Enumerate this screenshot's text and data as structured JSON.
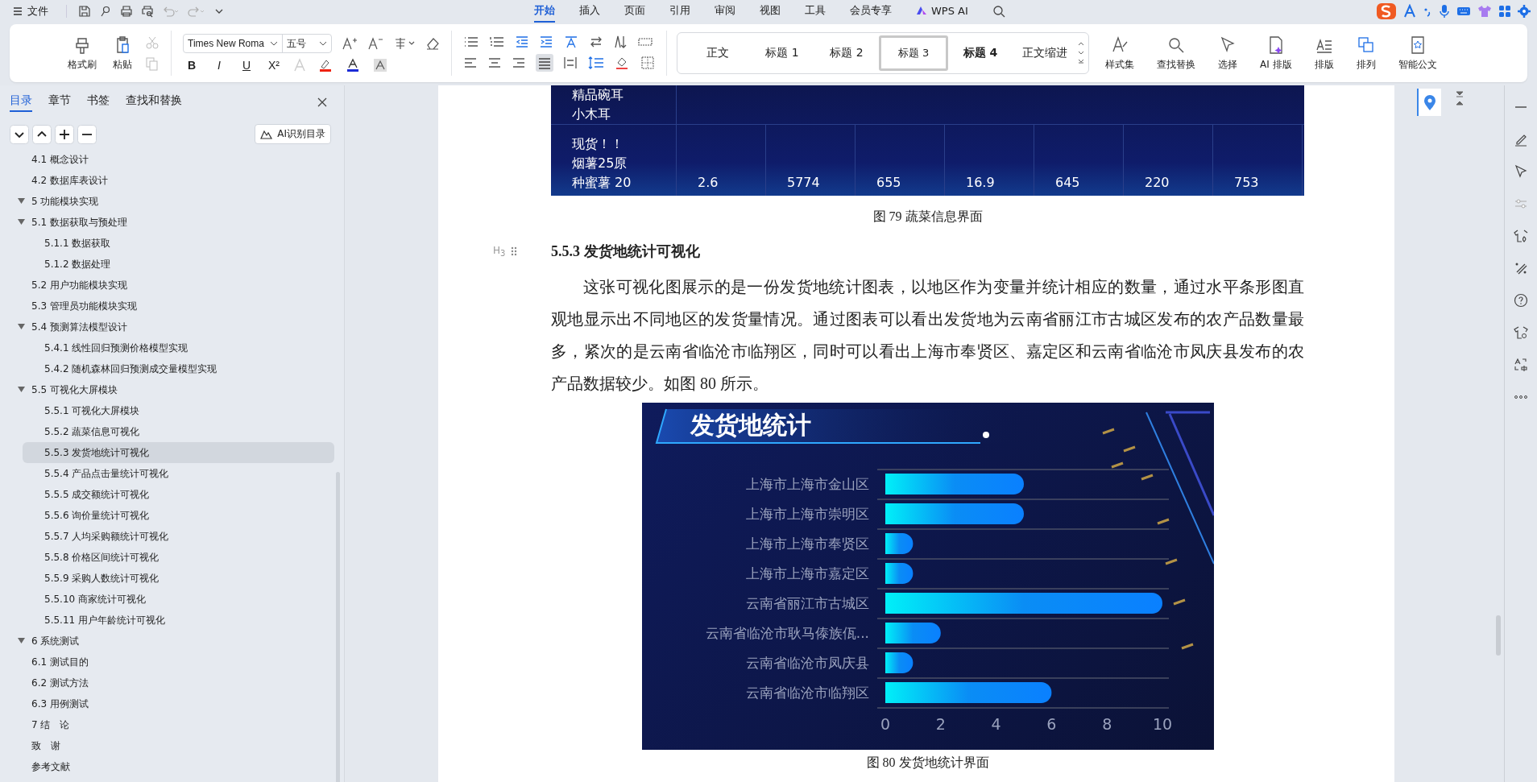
{
  "title_bar": {
    "file_menu": "文件",
    "tabs": [
      {
        "label": "开始",
        "selected": true
      },
      {
        "label": "插入",
        "selected": false
      },
      {
        "label": "页面",
        "selected": false
      },
      {
        "label": "引用",
        "selected": false
      },
      {
        "label": "审阅",
        "selected": false
      },
      {
        "label": "视图",
        "selected": false
      },
      {
        "label": "工具",
        "selected": false
      },
      {
        "label": "会员专享",
        "selected": false
      },
      {
        "label": "WPS AI",
        "selected": false
      }
    ]
  },
  "ribbon": {
    "clipboard": [
      "格式刷",
      "粘贴"
    ],
    "font_name": "Times New Roma",
    "font_size": "五号",
    "format_glyphs": [
      "B",
      "I",
      "U",
      "X²"
    ],
    "styles": [
      {
        "label": "正文",
        "selected": false
      },
      {
        "label": "标题 1",
        "selected": false
      },
      {
        "label": "标题 2",
        "selected": false
      },
      {
        "label": "标题 3",
        "selected": true
      },
      {
        "label": "标题 4",
        "selected": false
      },
      {
        "label": "正文缩进",
        "selected": false
      }
    ],
    "tools": [
      "样式集",
      "查找替换",
      "选择",
      "AI 排版",
      "排版",
      "排列",
      "智能公文"
    ]
  },
  "sidebar": {
    "tabs": [
      {
        "label": "目录",
        "selected": true
      },
      {
        "label": "章节",
        "selected": false
      },
      {
        "label": "书签",
        "selected": false
      },
      {
        "label": "查找和替换",
        "selected": false
      }
    ],
    "ai_button": "AI识别目录",
    "toc": [
      {
        "children": [
          {
            "label": "4.1 概念设计",
            "selected": false
          },
          {
            "label": "4.2 数据库表设计",
            "selected": false
          }
        ]
      },
      {
        "label": "5  功能模块实现",
        "expanded": true,
        "selected": false,
        "children": [
          {
            "label": "5.1  数据获取与预处理",
            "expanded": true,
            "selected": false,
            "children": [
              {
                "label": "5.1.1 数据获取",
                "selected": false
              },
              {
                "label": "5.1.2 数据处理",
                "selected": false
              }
            ]
          },
          {
            "label": "5.2  用户功能模块实现",
            "selected": false
          },
          {
            "label": "5.3  管理员功能模块实现",
            "selected": false
          },
          {
            "label": "5.4  预测算法模型设计",
            "expanded": true,
            "selected": false,
            "children": [
              {
                "label": "5.4.1  线性回归预测价格模型实现",
                "selected": false
              },
              {
                "label": "5.4.2  随机森林回归预测成交量模型实现",
                "selected": false
              }
            ]
          },
          {
            "label": "5.5  可视化大屏模块",
            "expanded": true,
            "selected": false,
            "children": [
              {
                "label": "5.5.1 可视化大屏模块",
                "selected": false
              },
              {
                "label": "5.5.2  蔬菜信息可视化",
                "selected": false
              },
              {
                "label": "5.5.3  发货地统计可视化",
                "selected": true
              },
              {
                "label": "5.5.4  产品点击量统计可视化",
                "selected": false
              },
              {
                "label": "5.5.5  成交额统计可视化",
                "selected": false
              },
              {
                "label": "5.5.6  询价量统计可视化",
                "selected": false
              },
              {
                "label": "5.5.7  人均采购额统计可视化",
                "selected": false
              },
              {
                "label": "5.5.8  价格区间统计可视化",
                "selected": false
              },
              {
                "label": "5.5.9  采购人数统计可视化",
                "selected": false
              },
              {
                "label": "5.5.10  商家统计可视化",
                "selected": false
              },
              {
                "label": "5.5.11 用户年龄统计可视化",
                "selected": false
              }
            ]
          }
        ]
      },
      {
        "label": "6 系统测试",
        "expanded": true,
        "selected": false,
        "children": [
          {
            "label": "6.1  测试目的",
            "selected": false
          },
          {
            "label": "6.2  测试方法",
            "selected": false
          },
          {
            "label": "6.3  用例测试",
            "selected": false
          }
        ]
      },
      {
        "label": "7 结　论",
        "selected": false
      },
      {
        "label": "致　谢",
        "selected": false
      },
      {
        "label": "参考文献",
        "selected": false
      }
    ]
  },
  "document": {
    "table_image": {
      "rows": [
        {
          "cells": [
            [
              "精品碗耳",
              "小木耳"
            ]
          ]
        },
        {
          "cells": [
            [
              "现货！！",
              "烟薯25原",
              "种蜜薯 20"
            ],
            [
              "2.6"
            ],
            [
              "5774"
            ],
            [
              "655"
            ],
            [
              "16.9"
            ],
            [
              "645"
            ],
            [
              "220"
            ],
            [
              "753"
            ]
          ]
        }
      ]
    },
    "caption_1": "图 79  蔬菜信息界面",
    "heading_mark": "H$_{3}$",
    "heading": "5.5.3  发货地统计可视化",
    "paragraph": "这张可视化图展示的是一份发货地统计图表，以地区作为变量并统计相应的数量，通过水平条形图直观地显示出不同地区的发货量情况。通过图表可以看出发货地为云南省丽江市古城区发布的农产品数量最多，紧次的是云南省临沧市临翔区，同时可以看出上海市奉贤区、嘉定区和云南省临沧市凤庆县发布的农产品数据较少。如图 80 所示。",
    "chart_data": {
      "type": "bar",
      "orientation": "horizontal",
      "title": "发货地统计",
      "categories": [
        "上海市上海市金山区",
        "上海市上海市崇明区",
        "上海市上海市奉贤区",
        "上海市上海市嘉定区",
        "云南省丽江市古城区",
        "云南省临沧市耿马傣族佤...",
        "云南省临沧市凤庆县",
        "云南省临沧市临翔区"
      ],
      "values": [
        5,
        5,
        1,
        1,
        10,
        2,
        1,
        6
      ],
      "xlim": [
        0,
        10
      ],
      "xticks": [
        0,
        2,
        4,
        6,
        8,
        10
      ]
    },
    "caption_2": "图 80  发货地统计界面"
  }
}
